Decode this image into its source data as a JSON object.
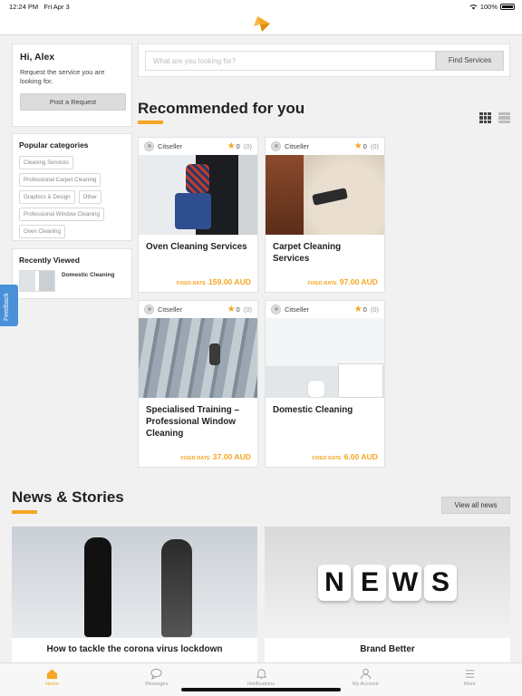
{
  "status": {
    "time": "12:24 PM",
    "date": "Fri Apr 3",
    "battery": "100%"
  },
  "welcome": {
    "title": "Hi, Alex",
    "text": "Request the service you are looking for.",
    "button": "Post a Request"
  },
  "categories": {
    "title": "Popular categories",
    "items": [
      "Cleaning Services",
      "Professional Carpet Cleaning",
      "Graphics & Design",
      "Other",
      "Professional Window Cleaning",
      "Oven Cleaning"
    ]
  },
  "recently_viewed": {
    "title": "Recently Viewed",
    "item": "Domestic Cleaning"
  },
  "feedback": "Feedback",
  "search": {
    "placeholder": "What are you looking for?",
    "button": "Find Services"
  },
  "recommended": {
    "title": "Recommended for you",
    "cards": [
      {
        "seller": "Citseller",
        "rating": "0",
        "count": "(0)",
        "title": "Oven Cleaning Services",
        "rate_label": "FIXED RATE",
        "price": "159.00 AUD"
      },
      {
        "seller": "Citseller",
        "rating": "0",
        "count": "(0)",
        "title": "Carpet Cleaning Services",
        "rate_label": "FIXED RATE",
        "price": "97.00 AUD"
      },
      {
        "seller": "Citseller",
        "rating": "0",
        "count": "(0)",
        "title": "Specialised Training – Professional Window Cleaning",
        "rate_label": "FIXED RATE",
        "price": "37.00 AUD"
      },
      {
        "seller": "Citseller",
        "rating": "0",
        "count": "(0)",
        "title": "Domestic Cleaning",
        "rate_label": "FIXED RATE",
        "price": "6.00 AUD"
      }
    ]
  },
  "news": {
    "title": "News & Stories",
    "view_all": "View all news",
    "items": [
      {
        "title": "How to tackle the corona virus lockdown"
      },
      {
        "title": "Brand Better"
      }
    ],
    "dice_letters": [
      "N",
      "E",
      "W",
      "S"
    ]
  },
  "tabs": [
    {
      "label": "Home",
      "icon": "home-icon"
    },
    {
      "label": "Messages",
      "icon": "chat-icon"
    },
    {
      "label": "Notifications",
      "icon": "bell-icon"
    },
    {
      "label": "My Account",
      "icon": "user-icon"
    },
    {
      "label": "More",
      "icon": "menu-icon"
    }
  ],
  "colors": {
    "accent": "#f5a623",
    "feedback": "#4a90d9"
  }
}
